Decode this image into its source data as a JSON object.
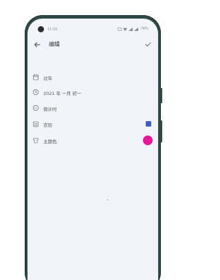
{
  "status_bar": {
    "time": "11:50",
    "battery": "76%"
  },
  "header": {
    "title": "编辑"
  },
  "rows": [
    {
      "label": "过年",
      "icon": "calendar-icon"
    },
    {
      "label": "2021 年 一月 初一",
      "icon": "clock-icon"
    },
    {
      "label": "倒计时",
      "icon": "countdown-icon"
    },
    {
      "label": "农历",
      "icon": "lunar-calendar-icon",
      "checked": true
    },
    {
      "label": "主题色",
      "icon": "shirt-icon",
      "theme_color": "#e8149a"
    }
  ],
  "colors": {
    "accent_checkbox": "#3f5fc0",
    "theme_color": "#e8149a",
    "screen_background": "#f3f3fb",
    "frame": "#2f4a44"
  }
}
